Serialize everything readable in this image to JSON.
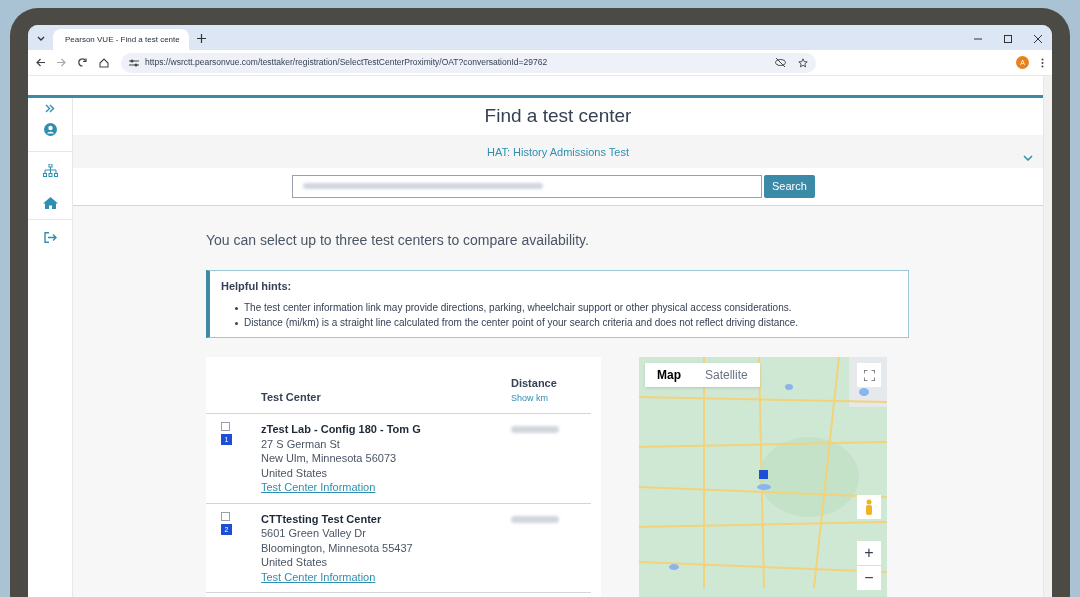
{
  "browser": {
    "tab_title": "Pearson VUE - Find a test cente",
    "url": "https://wsrctt.pearsonvue.com/testtaker/registration/SelectTestCenterProximity/OAT?conversationId=29762",
    "profile_initial": "A"
  },
  "page": {
    "title": "Find a test center",
    "exam": "HAT: History Admissions Test",
    "exam_expanded": false,
    "search_button": "Search",
    "intro": "You can select up to three test centers to compare availability.",
    "hints_title": "Helpful hints:",
    "hints": [
      "The test center information link may provide directions, parking, wheelchair support or other physical access considerations.",
      "Distance (mi/km) is a straight line calculated from the center point of your search criteria and does not reflect driving distance."
    ],
    "table": {
      "column_center": "Test Center",
      "column_distance": "Distance",
      "distance_toggle": "Show km",
      "rows": [
        {
          "marker": "1",
          "checked": false,
          "name": "zTest Lab - Config 180 - Tom G",
          "lines": [
            "27 S German St",
            "New Ulm, Minnesota 56073",
            "United States"
          ],
          "link": "Test Center Information"
        },
        {
          "marker": "2",
          "checked": false,
          "name": "CTTtesting Test Center",
          "lines": [
            "5601 Green Valley Dr",
            "Bloomington, Minnesota 55437",
            "United States"
          ],
          "link": "Test Center Information"
        }
      ]
    },
    "map": {
      "tabs": [
        {
          "label": "Map",
          "selected": true
        },
        {
          "label": "Satellite",
          "selected": false
        }
      ],
      "zoom_in": "+",
      "zoom_out": "−"
    }
  }
}
